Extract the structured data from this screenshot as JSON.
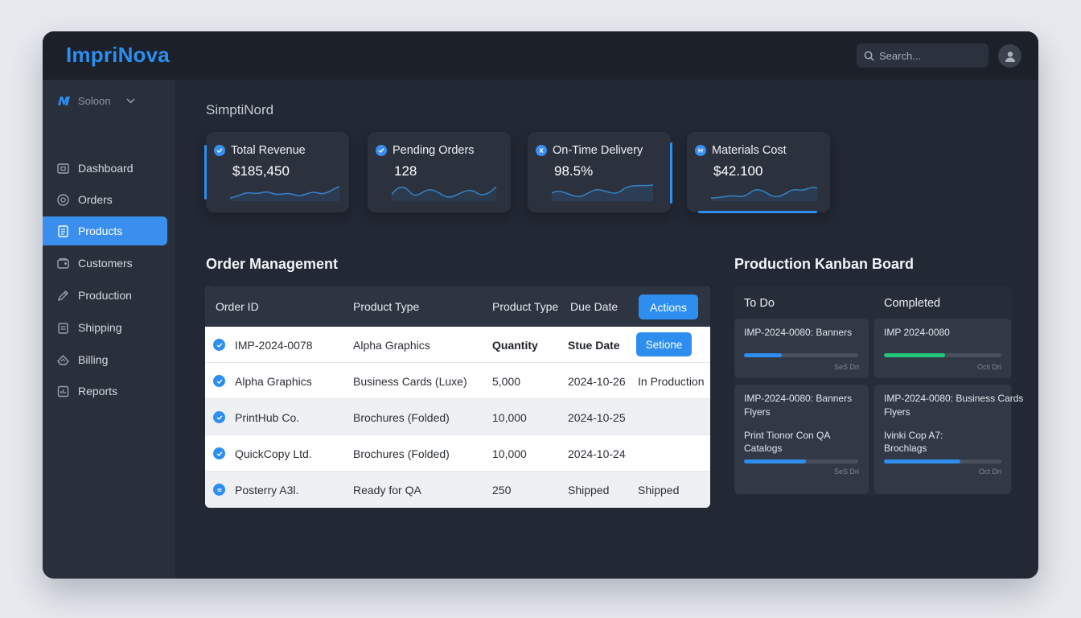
{
  "app": {
    "brand": "ImpriNova"
  },
  "header": {
    "search_placeholder": "Search..."
  },
  "sidebar": {
    "workspace": "Soloon",
    "items": [
      {
        "label": "Dashboard",
        "icon": "dashboard-icon"
      },
      {
        "label": "Orders",
        "icon": "orders-icon"
      },
      {
        "label": "Products",
        "icon": "products-icon",
        "active": true
      },
      {
        "label": "Customers",
        "icon": "customers-icon"
      },
      {
        "label": "Production",
        "icon": "production-icon"
      },
      {
        "label": "Shipping",
        "icon": "shipping-icon"
      },
      {
        "label": "Billing",
        "icon": "billing-icon"
      },
      {
        "label": "Reports",
        "icon": "reports-icon"
      }
    ]
  },
  "main": {
    "title": "SimptiNord"
  },
  "kpis": [
    {
      "label": "Total Revenue",
      "value": "$185,450"
    },
    {
      "label": "Pending Orders",
      "value": "128"
    },
    {
      "label": "On-Time Delivery",
      "value": "98.5%"
    },
    {
      "label": "Materials Cost",
      "value": "$42.100"
    }
  ],
  "orders": {
    "title": "Order Management",
    "headers": [
      "Order ID",
      "Product Type",
      "Product Type",
      "Due Date"
    ],
    "actions_label": "Actions",
    "rows": [
      {
        "c1": "IMP-2024-0078",
        "c2": "Alpha Graphics",
        "c3": "Quantity",
        "c4": "Stue Date",
        "button": "Setione"
      },
      {
        "c1": "Alpha Graphics",
        "c2": "Business Cards (Luxe)",
        "c3": "5,000",
        "c4": "2024-10-26",
        "c5": "In Production"
      },
      {
        "c1": "PrintHub Co.",
        "c2": "Brochures (Folded)",
        "c3": "10,000",
        "c4": "2024-10-25",
        "c5": ""
      },
      {
        "c1": "QuickCopy Ltd.",
        "c2": "Brochures (Folded)",
        "c3": "10,000",
        "c4": "2024-10-24",
        "c5": ""
      },
      {
        "c1": "Posterry A3l.",
        "c2": "Ready for QA",
        "c3": "250",
        "c4": "Shipped",
        "c5": "Shipped"
      }
    ]
  },
  "kanban": {
    "title": "Production Kanban Board",
    "columns": [
      {
        "title": "To Do",
        "cards": [
          {
            "line1": "IMP-2024-0080: Banners",
            "meta": "SeS Dri",
            "progress": 0.33,
            "color": "#2d8ef0"
          },
          {
            "line1": "IMP-2024-0080: Banners",
            "line2": "Flyers",
            "line3": "Print Tionor Con QA",
            "line4": "Catalogs",
            "meta": "SeS Dri",
            "progress": 0.54,
            "color": "#2d8ef0"
          }
        ]
      },
      {
        "title": "Completed",
        "cards": [
          {
            "line1": "IMP 2024-0080",
            "meta": "Octi Dri",
            "progress": 0.52,
            "color": "#22c77a"
          },
          {
            "line1": "IMP-2024-0080: Business Cards",
            "line2": "Flyers",
            "line3": "Ivinki Cop A7:",
            "line4": "Brochlags",
            "meta": "Oct Dri",
            "progress": 0.65,
            "color": "#2d8ef0"
          }
        ]
      }
    ]
  }
}
